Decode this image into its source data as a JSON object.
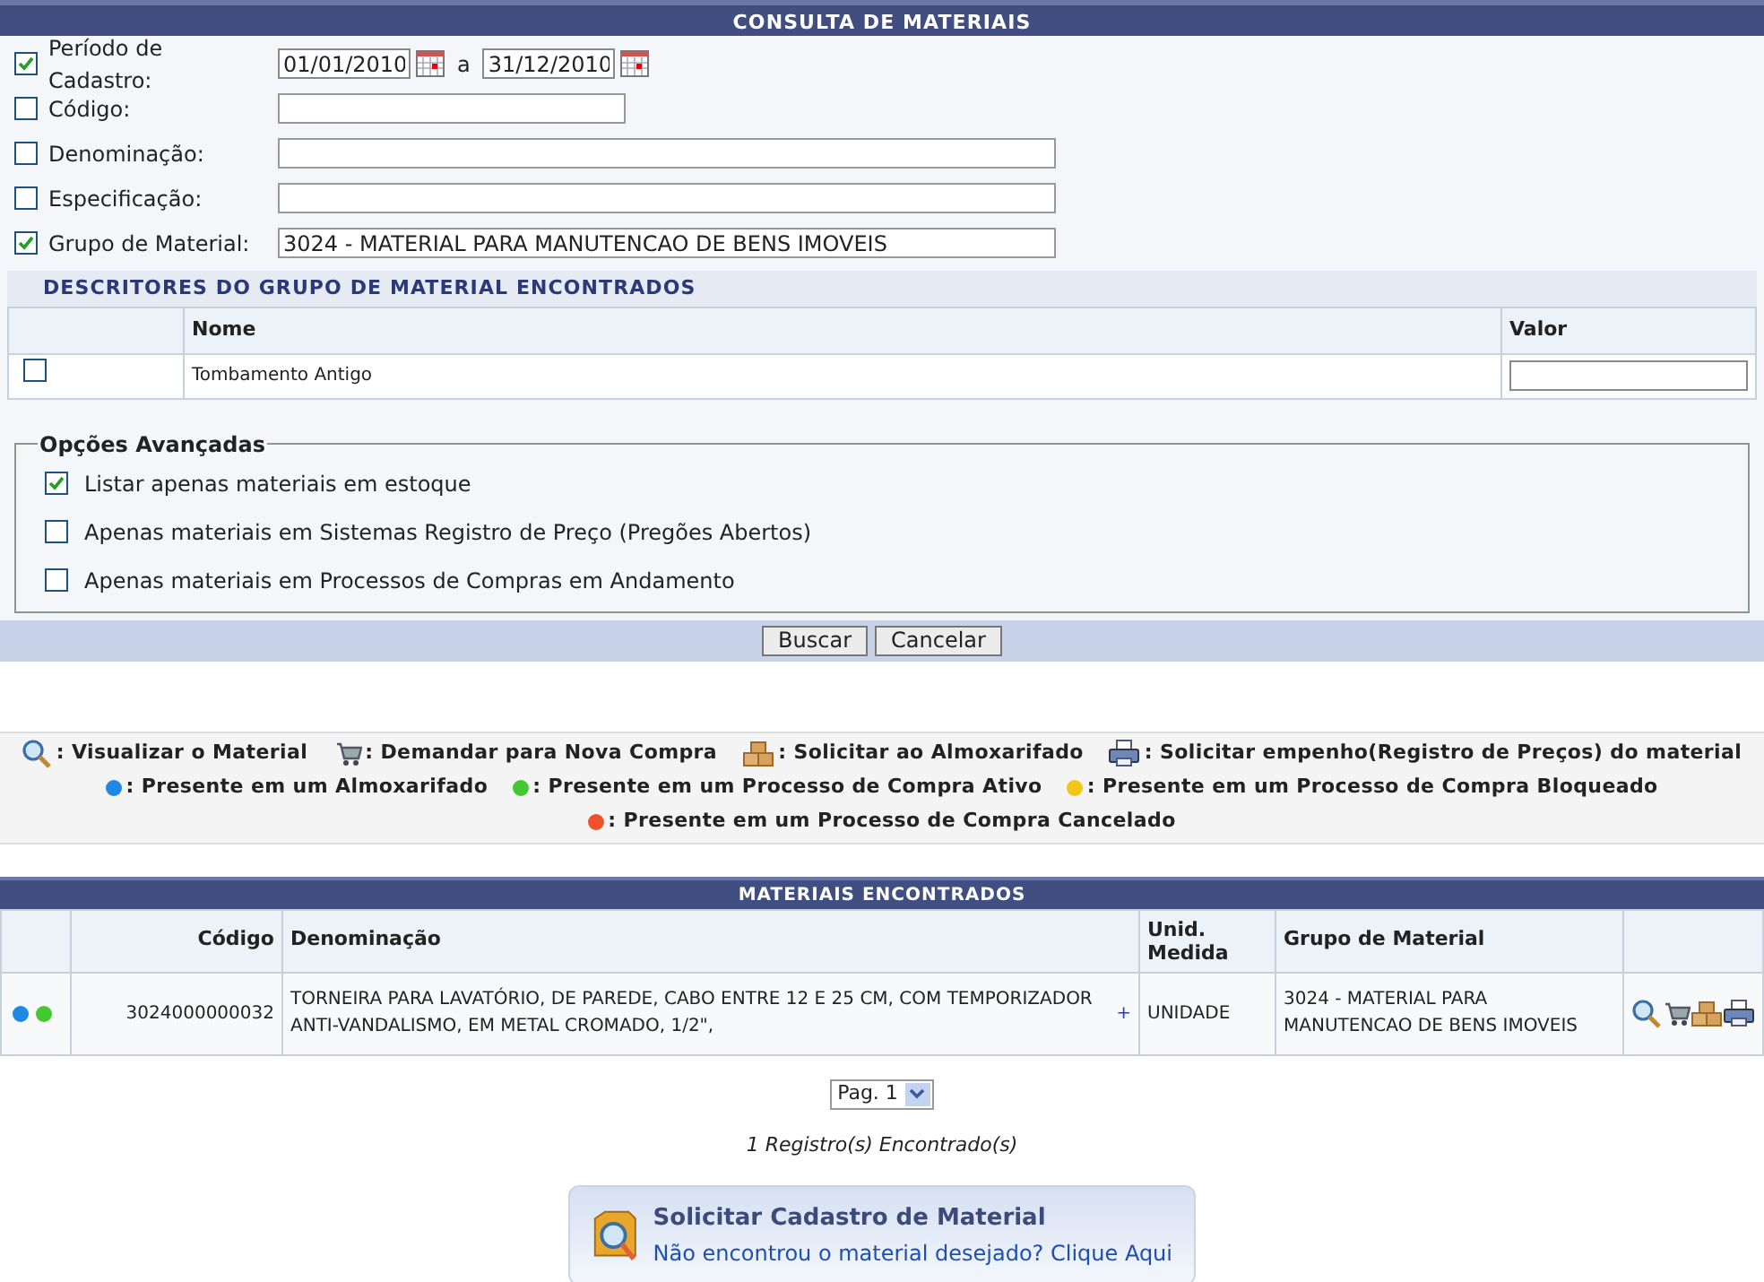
{
  "form": {
    "title": "CONSULTA DE MATERIAIS",
    "filters": [
      {
        "kind": "period",
        "label": "Período de Cadastro:",
        "checked": true,
        "value": "01/01/2010",
        "between": "a",
        "value_end": "31/12/2010"
      },
      {
        "kind": "short",
        "label": "Código:",
        "checked": false
      },
      {
        "kind": "long",
        "label": "Denominação:",
        "checked": false
      },
      {
        "kind": "long",
        "label": "Especificação:",
        "checked": false
      },
      {
        "kind": "long",
        "label": "Grupo de Material:",
        "checked": true,
        "value": "3024 - MATERIAL PARA MANUTENCAO DE BENS IMOVEIS"
      }
    ],
    "descriptors": {
      "title": "DESCRITORES DO GRUPO DE MATERIAL ENCONTRADOS",
      "columns": [
        "Nome",
        "Valor"
      ],
      "rows": [
        {
          "checked": false,
          "name": "Tombamento Antigo"
        }
      ]
    },
    "advanced": {
      "legend": "Opções Avançadas",
      "options": [
        {
          "label": "Listar apenas materiais em estoque",
          "checked": true
        },
        {
          "label": "Apenas materiais em Sistemas Registro de Preço (Pregões Abertos)",
          "checked": false
        },
        {
          "label": "Apenas materiais em Processos de Compras em Andamento",
          "checked": false
        }
      ]
    },
    "buttons": [
      "Buscar",
      "Cancelar"
    ]
  },
  "legend": {
    "lines": [
      [
        {
          "kind": "magnifier",
          "text": ": Visualizar o Material"
        },
        {
          "kind": "cart",
          "text": ": Demandar para Nova Compra"
        },
        {
          "kind": "box",
          "text": ": Solicitar ao Almoxarifado"
        },
        {
          "kind": "printer",
          "text": ": Solicitar empenho(Registro de Preços) do material"
        }
      ],
      [
        {
          "kind": "dot",
          "color": "#1e88e5",
          "text": ": Presente em um Almoxarifado"
        },
        {
          "kind": "dot",
          "color": "#43c831",
          "text": ": Presente em um Processo de Compra Ativo"
        },
        {
          "kind": "dot",
          "color": "#f5c518",
          "text": ": Presente em um Processo de Compra Bloqueado"
        }
      ],
      [
        {
          "kind": "dot",
          "color": "#f0502a",
          "text": ": Presente em um Processo de Compra Cancelado"
        }
      ]
    ]
  },
  "results": {
    "title": "MATERIAIS ENCONTRADOS",
    "columns": [
      "Código",
      "Denominação",
      "Unid. Medida",
      "Grupo de Material"
    ],
    "rows": [
      {
        "status": [
          {
            "color": "#1e88e5"
          },
          {
            "color": "#43c831"
          }
        ],
        "codigo": "3024000000032",
        "denominacao": "TORNEIRA PARA LAVATÓRIO, DE PAREDE, CABO ENTRE 12 E 25 CM, COM TEMPORIZADOR ANTI-VANDALISMO, EM METAL CROMADO, 1/2\",",
        "expand": "+",
        "unidade": "UNIDADE",
        "grupo": "3024 - MATERIAL PARA MANUTENCAO DE BENS IMOVEIS"
      }
    ]
  },
  "pager": {
    "value": "Pag. 1"
  },
  "count": "1 Registro(s) Encontrado(s)",
  "request": {
    "title": "Solicitar Cadastro de Material",
    "link": "Não encontrou o material desejado? Clique Aqui"
  }
}
